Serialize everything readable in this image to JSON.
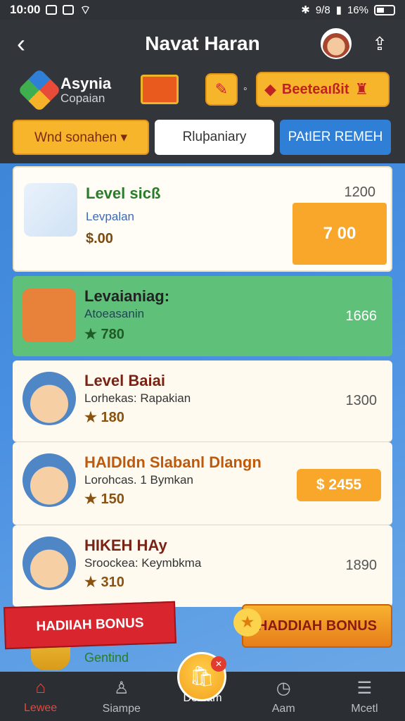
{
  "status_bar": {
    "time": "10:00",
    "right_text": "9/8",
    "battery": "16%"
  },
  "header": {
    "title": "Navat Haran",
    "back_icon": "chevron-left-icon",
    "share_icon": "share-icon"
  },
  "brand": {
    "name": "Asynia",
    "subtitle": "Copaian",
    "bestseller_label": "Beeteaıßit"
  },
  "filters": {
    "chip1": "Wnd sonahen ▾",
    "chip2": "Rluþaniary",
    "chip3": "PAtIER REMEH"
  },
  "cards": [
    {
      "title": "Level sicß",
      "sub": "Levpalan",
      "price": "$.00",
      "count": "1200",
      "action": "7 00"
    },
    {
      "title": "Levaianiag:",
      "sub": "Atoeasanin",
      "price": "★ 780",
      "count": "1666"
    },
    {
      "title": "Level Baiai",
      "sub": "Lorhekas: Rapakian",
      "price": "★ 180",
      "count": "1300"
    },
    {
      "title": "HAIDldn Slabanl Dlangn",
      "sub": "Lorohcas. 1 Bymkan",
      "price": "★ 150",
      "count": "",
      "action": "$ 2455"
    },
    {
      "title": "HIKEH HAy",
      "sub": "Sroockea: Keymbkma",
      "price": "★ 310",
      "count": "1890"
    }
  ],
  "bonus": {
    "left": "HADIIAH BONUS",
    "right": "HADDIAH BONUS",
    "gentind": "Gentind"
  },
  "nav": [
    {
      "label": "Lewee",
      "icon": "home-icon"
    },
    {
      "label": "Siampe",
      "icon": "user-icon"
    },
    {
      "label": "Denlam",
      "icon": "shop-icon"
    },
    {
      "label": "Aam",
      "icon": "clock-icon"
    },
    {
      "label": "Mcetl",
      "icon": "menu-icon"
    }
  ],
  "colors": {
    "accent": "#f7b52c",
    "green": "#5fc07a",
    "blue": "#2f7fd7",
    "red": "#d8252e"
  }
}
